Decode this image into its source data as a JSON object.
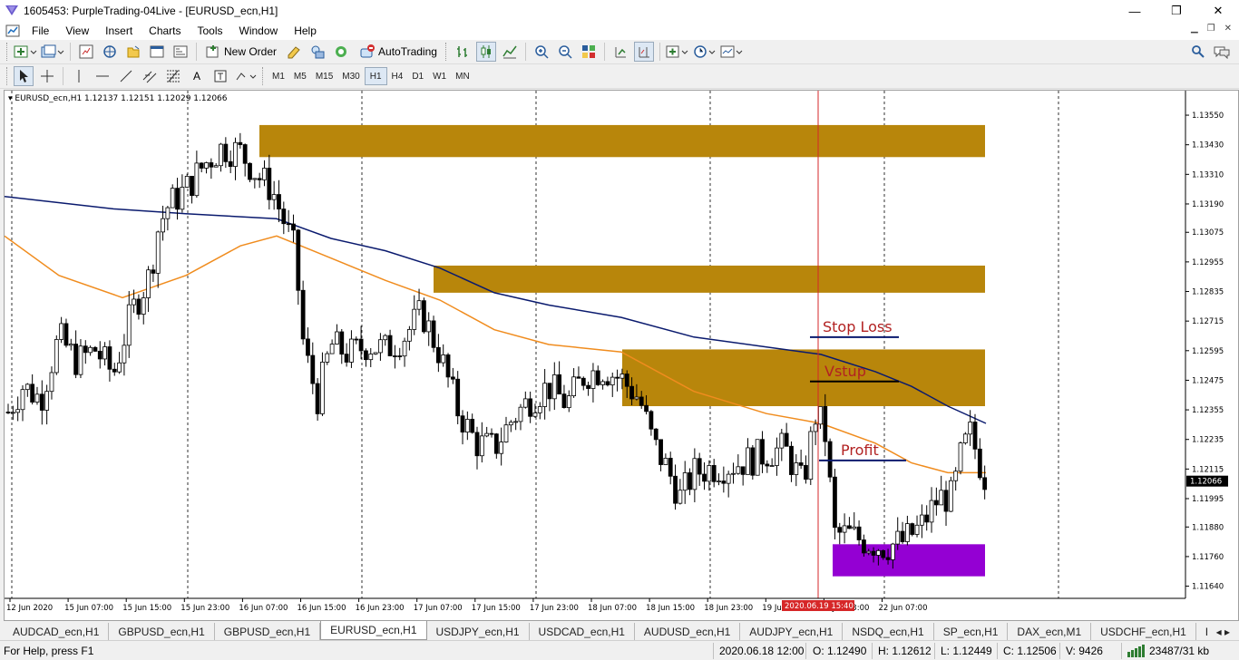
{
  "window": {
    "title": "1605453: PurpleTrading-04Live - [EURUSD_ecn,H1]",
    "minimize": "—",
    "restore": "❐",
    "close": "✕"
  },
  "menu": {
    "items": [
      "File",
      "View",
      "Insert",
      "Charts",
      "Tools",
      "Window",
      "Help"
    ]
  },
  "toolbar": {
    "new_order": "New Order",
    "autotrading": "AutoTrading"
  },
  "timeframes": [
    "M1",
    "M5",
    "M15",
    "M30",
    "H1",
    "H4",
    "D1",
    "W1",
    "MN"
  ],
  "active_timeframe": "H1",
  "chart": {
    "info": "EURUSD_ecn,H1  1.12137 1.12151 1.12029 1.12066",
    "current_price": "1.12066",
    "cursor_time": "2020.06.19 15:40",
    "annotations": {
      "stop_loss": "Stop Loss",
      "entry": "Vstup",
      "profit": "Profit"
    },
    "colors": {
      "zone": "#b8860b",
      "target_zone": "#9400d3",
      "ma_fast": "#f08c1e",
      "ma_slow": "#0a1a6e",
      "annotation_text": "#b22222",
      "level_line": "#0a1a6e",
      "cursor_line": "#d62728"
    }
  },
  "chart_data": {
    "type": "candlestick",
    "symbol": "EURUSD_ecn",
    "timeframe": "H1",
    "y_ticks": [
      "1.13550",
      "1.13430",
      "1.13310",
      "1.13190",
      "1.13075",
      "1.12955",
      "1.12835",
      "1.12715",
      "1.12595",
      "1.12475",
      "1.12355",
      "1.12235",
      "1.12115",
      "1.11995",
      "1.11880",
      "1.11760",
      "1.11640"
    ],
    "ylim": [
      1.1162,
      1.1362
    ],
    "x_ticks": [
      "12 Jun 2020",
      "15 Jun 07:00",
      "15 Jun 15:00",
      "15 Jun 23:00",
      "16 Jun 07:00",
      "16 Jun 15:00",
      "16 Jun 23:00",
      "17 Jun 07:00",
      "17 Jun 15:00",
      "17 Jun 23:00",
      "18 Jun 07:00",
      "18 Jun 15:00",
      "18 Jun 23:00",
      "19 Jun",
      "19 Jun 23:00",
      "22 Jun 07:00"
    ],
    "zones": [
      {
        "from": 1.1338,
        "to": 1.1351,
        "color": "#b8860b"
      },
      {
        "from": 1.1283,
        "to": 1.1294,
        "color": "#b8860b"
      },
      {
        "from": 1.1237,
        "to": 1.126,
        "color": "#b8860b"
      },
      {
        "from": 1.1168,
        "to": 1.1181,
        "color": "#9400d3"
      }
    ],
    "levels": {
      "stop_loss": 1.1265,
      "entry": 1.1247,
      "profit": 1.1215
    }
  },
  "tabs": [
    "AUDCAD_ecn,H1",
    "GBPUSD_ecn,H1",
    "GBPUSD_ecn,H1",
    "EURUSD_ecn,H1",
    "USDJPY_ecn,H1",
    "USDCAD_ecn,H1",
    "AUDUSD_ecn,H1",
    "AUDJPY_ecn,H1",
    "NSDQ_ecn,H1",
    "SP_ecn,H1",
    "DAX_ecn,M1",
    "USDCHF_ecn,H1",
    "EURAUD_ecn,"
  ],
  "active_tab": 3,
  "status": {
    "help": "For Help, press F1",
    "datetime": "2020.06.18 12:00",
    "open": "O: 1.12490",
    "high": "H: 1.12612",
    "low": "L: 1.12449",
    "close": "C: 1.12506",
    "volume": "V: 9426",
    "traffic": "23487/31 kb"
  }
}
